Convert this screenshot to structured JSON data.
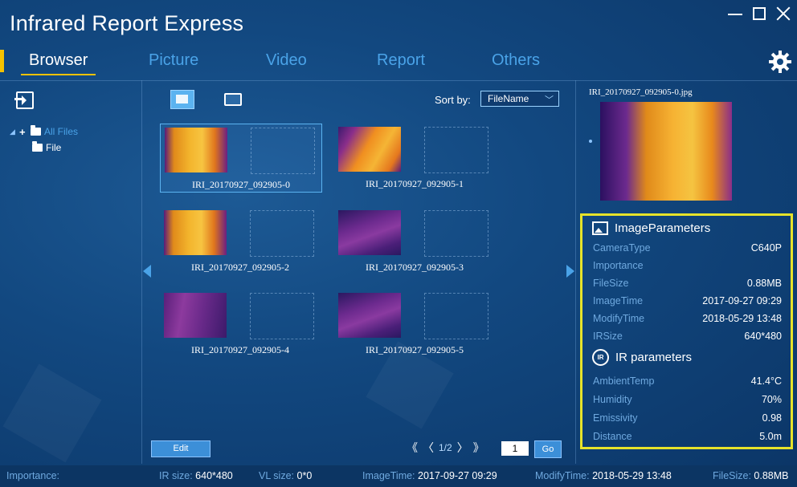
{
  "app": {
    "title": "Infrared Report Express"
  },
  "tabs": [
    {
      "label": "Browser",
      "active": true
    },
    {
      "label": "Picture",
      "active": false
    },
    {
      "label": "Video",
      "active": false
    },
    {
      "label": "Report",
      "active": false
    },
    {
      "label": "Others",
      "active": false
    }
  ],
  "tree": {
    "root": {
      "label": "All Files",
      "expander": "+"
    },
    "child": {
      "label": "File"
    }
  },
  "sort": {
    "label": "Sort by:",
    "value": "FileName"
  },
  "thumbnails": [
    {
      "caption": "IRI_20170927_092905-0",
      "selected": true,
      "palette": "hot"
    },
    {
      "caption": "IRI_20170927_092905-1",
      "selected": false,
      "palette": "hot2"
    },
    {
      "caption": "IRI_20170927_092905-2",
      "selected": false,
      "palette": "hot"
    },
    {
      "caption": "IRI_20170927_092905-3",
      "selected": false,
      "palette": "cold"
    },
    {
      "caption": "IRI_20170927_092905-4",
      "selected": false,
      "palette": "cold2"
    },
    {
      "caption": "IRI_20170927_092905-5",
      "selected": false,
      "palette": "cold"
    }
  ],
  "buttons": {
    "edit": "Edit",
    "go": "Go"
  },
  "pager": {
    "first": "《",
    "prev": "〈",
    "indicator": "1/2",
    "next": "〉",
    "last": "》",
    "page_value": "1"
  },
  "preview": {
    "filename": "IRI_20170927_092905-0.jpg"
  },
  "image_params": {
    "title": "ImageParameters",
    "rows": [
      {
        "key": "CameraType",
        "value": "C640P"
      },
      {
        "key": "Importance",
        "value": ""
      },
      {
        "key": "FileSize",
        "value": "0.88MB"
      },
      {
        "key": "ImageTime",
        "value": "2017-09-27 09:29"
      },
      {
        "key": "ModifyTime",
        "value": "2018-05-29 13:48"
      },
      {
        "key": "IRSize",
        "value": "640*480"
      }
    ]
  },
  "ir_params": {
    "title": "IR parameters",
    "icon_text": "IR",
    "rows": [
      {
        "key": "AmbientTemp",
        "value": "41.4°C"
      },
      {
        "key": "Humidity",
        "value": "70%"
      },
      {
        "key": "Emissivity",
        "value": "0.98"
      },
      {
        "key": "Distance",
        "value": "5.0m"
      }
    ]
  },
  "statusbar": {
    "importance_label": "Importance:",
    "ir_size_label": "IR size:",
    "ir_size": "640*480",
    "vl_size_label": "VL size:",
    "vl_size": "0*0",
    "image_time_label": "ImageTime:",
    "image_time": "2017-09-27 09:29",
    "modify_time_label": "ModifyTime:",
    "modify_time": "2018-05-29 13:48",
    "file_size_label": "FileSize:",
    "file_size": "0.88MB"
  },
  "colors": {
    "accent": "#f5c200",
    "highlight_box": "#e6e32a",
    "tab_inactive": "#4aa3e8",
    "background": "#124880"
  },
  "icons": [
    "import-icon",
    "gear-icon",
    "grid-view-icon",
    "single-view-icon",
    "image-icon",
    "ir-icon",
    "folder-icon"
  ]
}
